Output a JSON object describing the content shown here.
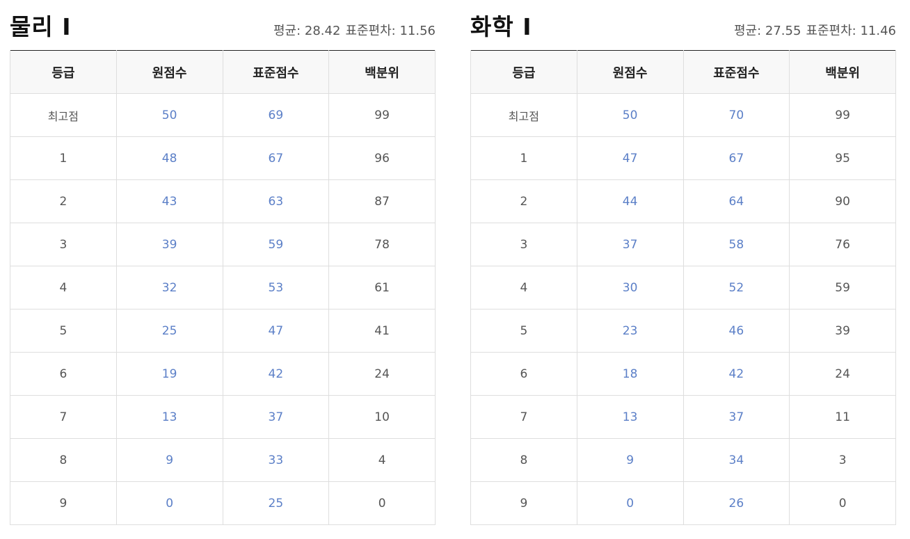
{
  "columns": [
    "등급",
    "원점수",
    "표준점수",
    "백분위"
  ],
  "panels": [
    {
      "title": "물리 Ⅰ",
      "stats": {
        "mean": "평균: 28.42",
        "sd": "표준편차: 11.56"
      },
      "rows": [
        [
          "최고점",
          "50",
          "69",
          "99"
        ],
        [
          "1",
          "48",
          "67",
          "96"
        ],
        [
          "2",
          "43",
          "63",
          "87"
        ],
        [
          "3",
          "39",
          "59",
          "78"
        ],
        [
          "4",
          "32",
          "53",
          "61"
        ],
        [
          "5",
          "25",
          "47",
          "41"
        ],
        [
          "6",
          "19",
          "42",
          "24"
        ],
        [
          "7",
          "13",
          "37",
          "10"
        ],
        [
          "8",
          "9",
          "33",
          "4"
        ],
        [
          "9",
          "0",
          "25",
          "0"
        ]
      ]
    },
    {
      "title": "화학 Ⅰ",
      "stats": {
        "mean": "평균: 27.55",
        "sd": "표준편차: 11.46"
      },
      "rows": [
        [
          "최고점",
          "50",
          "70",
          "99"
        ],
        [
          "1",
          "47",
          "67",
          "95"
        ],
        [
          "2",
          "44",
          "64",
          "90"
        ],
        [
          "3",
          "37",
          "58",
          "76"
        ],
        [
          "4",
          "30",
          "52",
          "59"
        ],
        [
          "5",
          "23",
          "46",
          "39"
        ],
        [
          "6",
          "18",
          "42",
          "24"
        ],
        [
          "7",
          "13",
          "37",
          "11"
        ],
        [
          "8",
          "9",
          "34",
          "3"
        ],
        [
          "9",
          "0",
          "26",
          "0"
        ]
      ]
    }
  ],
  "colors": {
    "link_blue": "#5b7fc7",
    "header_bg": "#f8f8f8",
    "border": "#dedede"
  }
}
